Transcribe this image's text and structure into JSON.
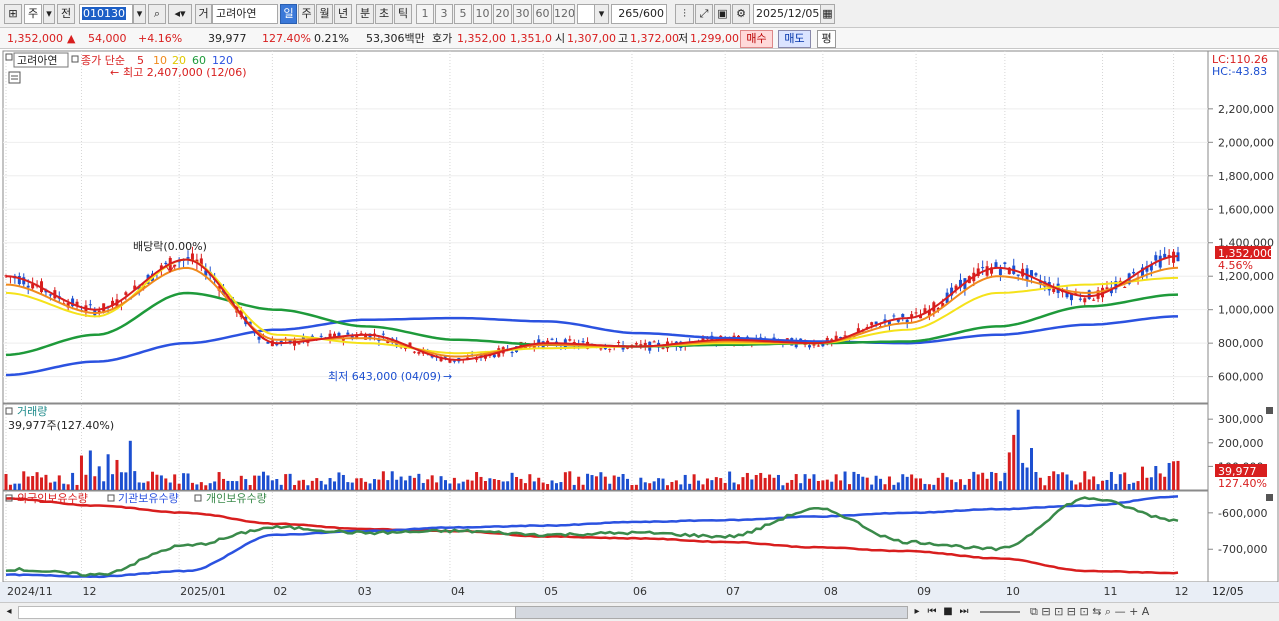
{
  "toolbar": {
    "market_type": "주",
    "prev_label": "전",
    "stock_code": "010130",
    "exchange_label": "거",
    "stock_name": "고려아연",
    "periods": [
      "일",
      "주",
      "월",
      "년",
      "분",
      "초",
      "틱"
    ],
    "active_period": "일",
    "intervals": [
      "1",
      "3",
      "5",
      "10",
      "20",
      "30",
      "60",
      "120"
    ],
    "count_value": "265",
    "count_total": "/600",
    "date": "2025/12/05"
  },
  "quote": {
    "price": "1,352,000",
    "change_arrow": "▲",
    "change": "54,000",
    "change_pct": "+4.16%",
    "volume": "39,977",
    "volume_ratio": "127.40%",
    "turnover": "0.21%",
    "amount": "53,306백만",
    "ask_label": "호가",
    "ask1": "1,352,00",
    "ask2": "1,351,0",
    "open_label": "시",
    "open": "1,307,00",
    "high_label": "고",
    "high": "1,372,00",
    "low_label": "저",
    "low": "1,299,00",
    "buy_label": "매수",
    "sell_label": "매도",
    "eq_label": "평"
  },
  "price_panel": {
    "stock_tag": "고려아연",
    "ma_title": "종가 단순",
    "ma_periods": [
      "5",
      "10",
      "20",
      "60",
      "120"
    ],
    "ma_colors": [
      "#d81e1e",
      "#f08a1c",
      "#f5e21a",
      "#1e9a3a",
      "#2b52e0"
    ],
    "max_label": "최고 2,407,000 (12/06)",
    "min_label": "최저 643,000 (04/09)",
    "dividend_label": "배당락(0.00%)",
    "lc_label": "LC:110.26",
    "hc_label": "HC:-43.83",
    "current_price": "1,352,000",
    "current_pct": "4.56%",
    "y_ticks": [
      "2,200,000",
      "2,000,000",
      "1,800,000",
      "1,600,000",
      "1,400,000",
      "1,200,000",
      "1,000,000",
      "800,000",
      "600,000"
    ]
  },
  "volume_panel": {
    "title": "거래량",
    "info": "39,977주(127.40%)",
    "current": "39,977",
    "current_pct": "127.40%",
    "y_ticks": [
      "300,000",
      "200,000",
      "100,000"
    ]
  },
  "holdings_panel": {
    "legend": [
      "외국인보유수량",
      "기관보유수량",
      "개인보유수량"
    ],
    "colors": [
      "#d81e1e",
      "#2b52e0",
      "#3a8a4a"
    ],
    "y_ticks": [
      "-600,000",
      "-700,000"
    ]
  },
  "x_axis": {
    "labels": [
      "2024/11",
      "12",
      "2025/01",
      "02",
      "03",
      "04",
      "05",
      "06",
      "07",
      "08",
      "09",
      "10",
      "11",
      "12"
    ],
    "right_label": "12/05"
  },
  "chart_data": {
    "type": "line",
    "title": "고려아연",
    "x": [
      "2024/11",
      "12",
      "2025/01",
      "02",
      "03",
      "04",
      "05",
      "06",
      "07",
      "08",
      "09",
      "10",
      "11",
      "12"
    ],
    "series": [
      {
        "name": "종가 단순 5",
        "values": [
          1200000,
          1000000,
          1300000,
          800000,
          850000,
          700000,
          800000,
          780000,
          820000,
          800000,
          950000,
          1250000,
          1080000,
          1320000
        ]
      },
      {
        "name": "종가 단순 10",
        "values": [
          1150000,
          980000,
          1250000,
          820000,
          830000,
          720000,
          790000,
          780000,
          810000,
          800000,
          920000,
          1200000,
          1100000,
          1250000
        ]
      },
      {
        "name": "종가 단순 20",
        "values": [
          1100000,
          960000,
          1300000,
          850000,
          800000,
          740000,
          770000,
          780000,
          800000,
          800000,
          880000,
          1100000,
          1150000,
          1190000
        ]
      },
      {
        "name": "종가 단순 60",
        "values": [
          730000,
          850000,
          1100000,
          1000000,
          900000,
          820000,
          790000,
          780000,
          790000,
          800000,
          810000,
          900000,
          1020000,
          1090000
        ]
      },
      {
        "name": "종가 단순 120",
        "values": [
          610000,
          690000,
          800000,
          880000,
          940000,
          950000,
          930000,
          860000,
          830000,
          810000,
          800000,
          850000,
          910000,
          960000
        ]
      }
    ],
    "ylim": [
      550000,
      2450000
    ],
    "annotations": [
      "최고 2,407,000 (12/06)",
      "최저 643,000 (04/09)",
      "배당락(0.00%)"
    ]
  }
}
